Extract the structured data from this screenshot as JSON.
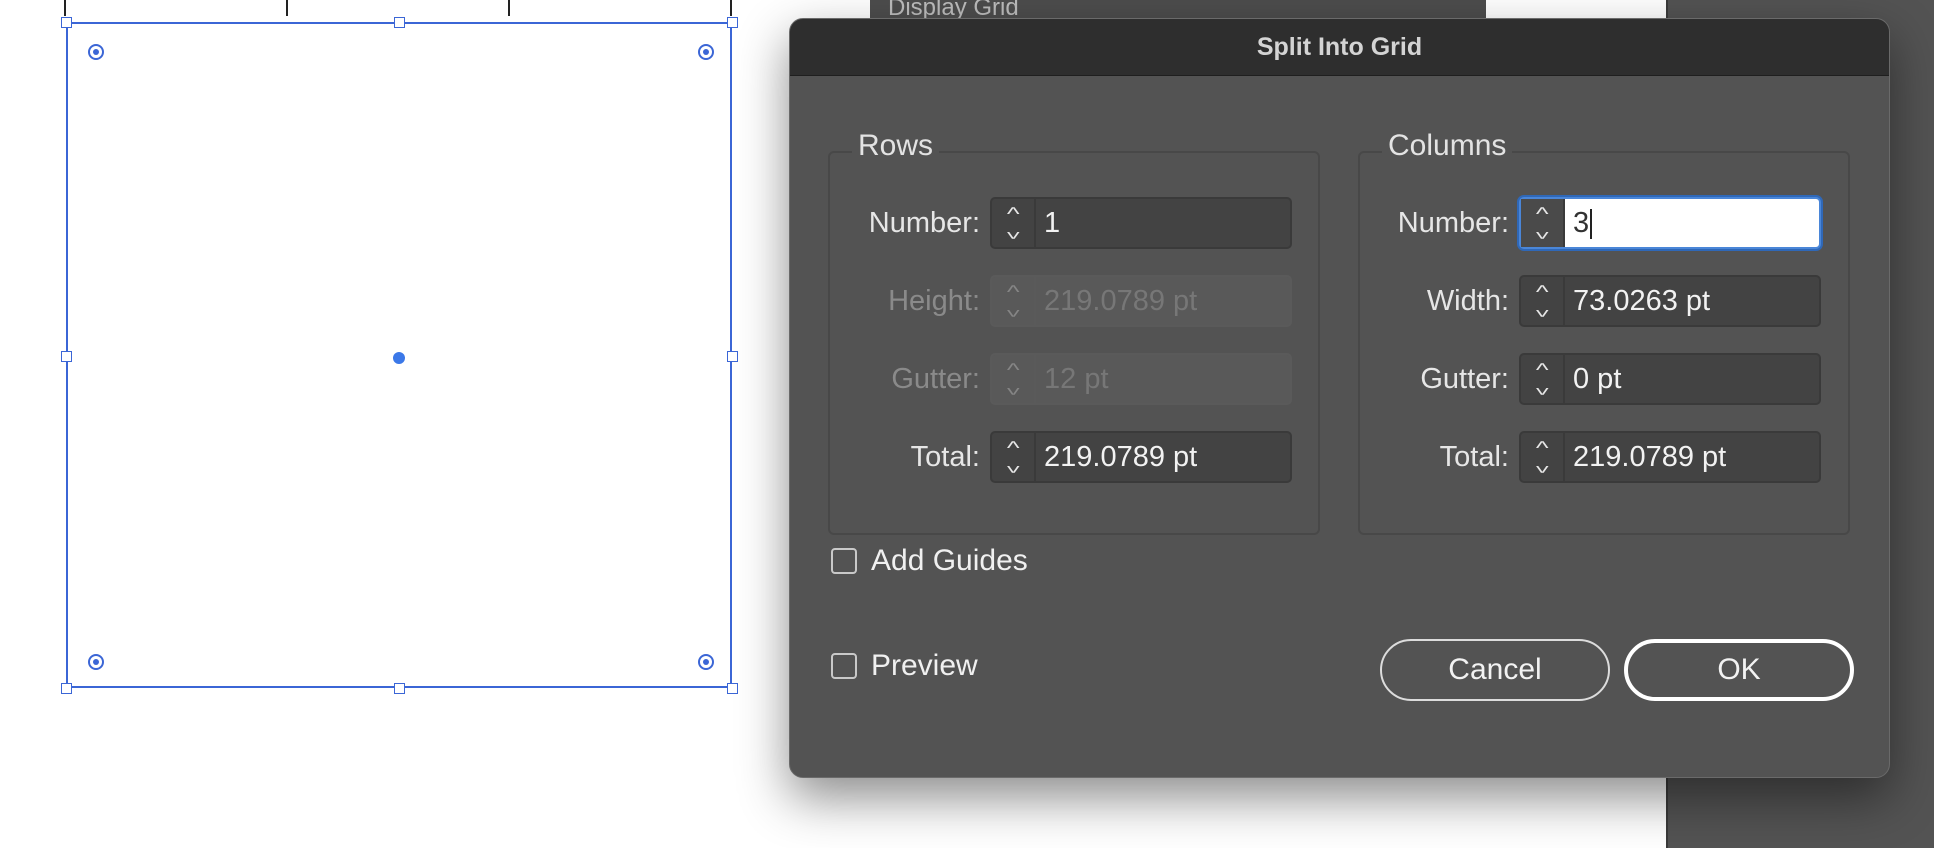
{
  "background_panel": {
    "title": "Display  Grid"
  },
  "dialog": {
    "title": "Split Into Grid",
    "rows": {
      "group_label": "Rows",
      "number": {
        "label": "Number:",
        "value": "1"
      },
      "height": {
        "label": "Height:",
        "value": "219.0789 pt",
        "enabled": false
      },
      "gutter": {
        "label": "Gutter:",
        "value": "12 pt",
        "enabled": false
      },
      "total": {
        "label": "Total:",
        "value": "219.0789 pt"
      }
    },
    "columns": {
      "group_label": "Columns",
      "number": {
        "label": "Number:",
        "value": "3",
        "focused": true
      },
      "width": {
        "label": "Width:",
        "value": "73.0263 pt"
      },
      "gutter": {
        "label": "Gutter:",
        "value": "0 pt"
      },
      "total": {
        "label": "Total:",
        "value": "219.0789 pt"
      }
    },
    "add_guides": {
      "label": "Add Guides",
      "checked": false
    },
    "preview": {
      "label": "Preview",
      "checked": false
    },
    "cancel_label": "Cancel",
    "ok_label": "OK"
  },
  "colors": {
    "selection": "#3b66d6",
    "dialog_bg": "#535353",
    "titlebar_bg": "#2e2e2e",
    "focus_ring": "#4a86d8"
  },
  "icons": [
    "stepper-arrows-icon",
    "corner-widget-icon",
    "checkbox-icon"
  ]
}
